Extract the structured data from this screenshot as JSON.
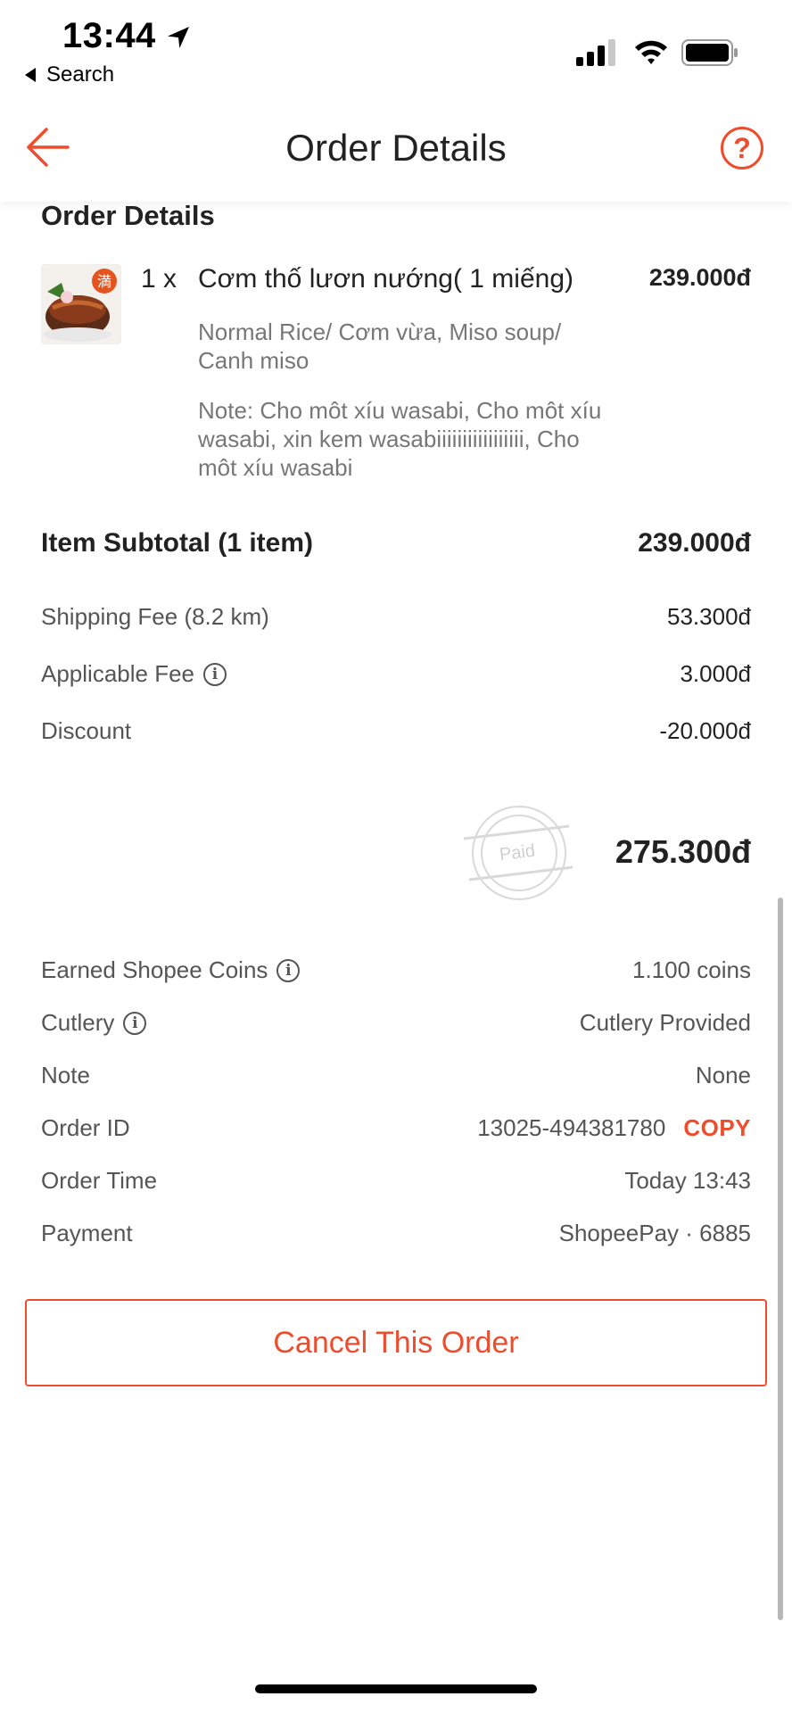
{
  "status_bar": {
    "time": "13:44",
    "back_app_label": "Search"
  },
  "nav": {
    "title": "Order Details",
    "help_label": "?"
  },
  "order": {
    "section_title": "Order Details",
    "item": {
      "quantity": "1 x",
      "name": "Cơm thố lươn nướng( 1 miếng)",
      "price": "239.000đ",
      "options": "Normal Rice/ Cơm vừa, Miso soup/ Canh miso",
      "note": "Note: Cho môt xíu wasabi, Cho môt xíu wasabi, xin kem wasabiiiiiiiiiiiiiiiii, Cho môt xíu wasabi"
    },
    "subtotal_label": "Item Subtotal (1 item)",
    "subtotal_value": "239.000đ",
    "fees": [
      {
        "label": "Shipping Fee (8.2 km)",
        "value": "53.300đ"
      },
      {
        "label": "Applicable Fee",
        "value": "3.000đ"
      },
      {
        "label": "Discount",
        "value": "-20.000đ"
      }
    ],
    "paid_stamp": "Paid",
    "total": "275.300đ"
  },
  "meta": {
    "coins_label": "Earned Shopee Coins",
    "coins_value": "1.100 coins",
    "cutlery_label": "Cutlery",
    "cutlery_value": "Cutlery Provided",
    "note_label": "Note",
    "note_value": "None",
    "order_id_label": "Order ID",
    "order_id_value": "13025-494381780",
    "copy_label": "COPY",
    "order_time_label": "Order Time",
    "order_time_value": "Today 13:43",
    "payment_label": "Payment",
    "payment_value": "ShopeePay · 6885"
  },
  "cancel_button": "Cancel This Order",
  "colors": {
    "accent": "#ee4d2d",
    "text": "#222222",
    "muted": "#777777"
  }
}
